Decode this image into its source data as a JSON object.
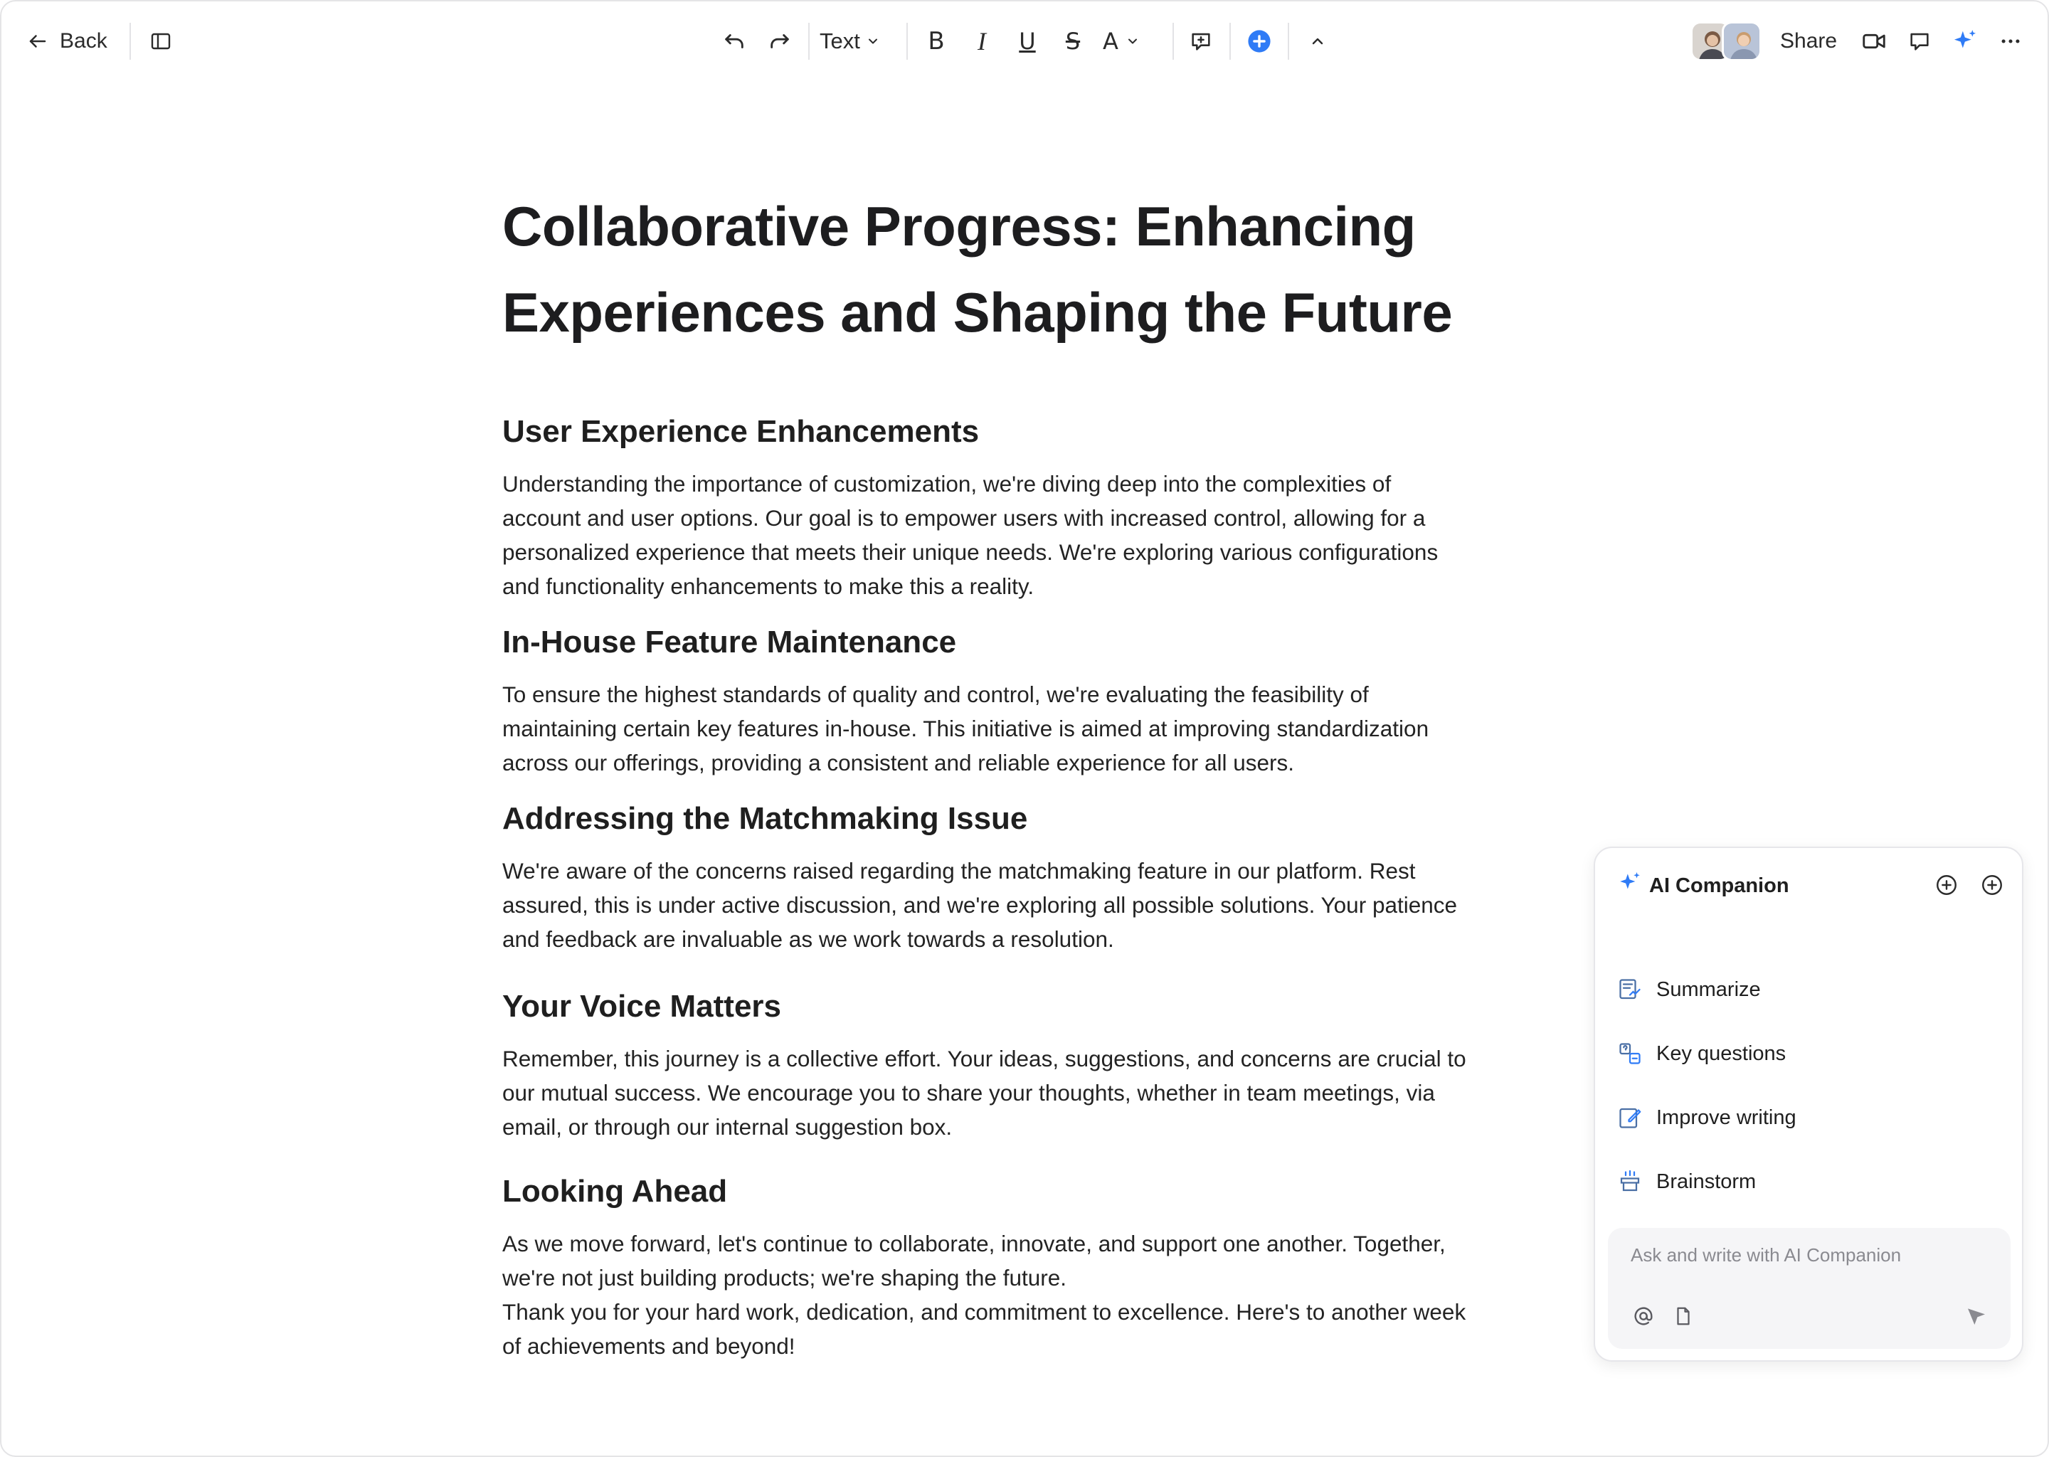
{
  "toolbar": {
    "back_label": "Back",
    "text_style_label": "Text",
    "bold_label": "B",
    "italic_label": "I",
    "underline_label": "U",
    "strike_label": "S",
    "font_color_label": "A",
    "share_label": "Share",
    "icons": [
      "arrow-left-icon",
      "sidebar-toggle-icon",
      "undo-icon",
      "redo-icon",
      "chevron-down-icon",
      "comment-add-icon",
      "plus-circle-icon",
      "chevron-up-icon",
      "video-icon",
      "chat-icon",
      "ai-sparkle-icon",
      "more-icon"
    ],
    "accent_color": "#2f7bf6"
  },
  "document": {
    "title_line1": "Collaborative Progress: Enhancing",
    "title_line2": "Experiences and Shaping the Future",
    "sections": [
      {
        "heading": "User Experience Enhancements",
        "lines": [
          "Understanding the importance of customization, we're diving deep into the complexities of",
          "account and user options. Our goal is to empower users with increased control, allowing for a",
          "personalized experience that meets their unique needs. We're exploring various configurations",
          "and functionality enhancements to make this a reality."
        ]
      },
      {
        "heading": "In-House Feature Maintenance",
        "lines": [
          "To ensure the highest standards of quality and control, we're evaluating the feasibility of",
          "maintaining certain key features in-house. This initiative is aimed at improving standardization",
          "across our offerings, providing a consistent and reliable experience for all users."
        ]
      },
      {
        "heading": "Addressing the Matchmaking Issue",
        "lines": [
          "We're aware of the concerns raised regarding the matchmaking feature in our platform. Rest",
          "assured, this is under active discussion, and we're exploring all possible solutions. Your patience",
          "and feedback are invaluable as we work towards a resolution."
        ]
      },
      {
        "heading": "Your Voice Matters",
        "lines": [
          "Remember, this journey is a collective effort. Your ideas, suggestions, and concerns are crucial to",
          "our mutual success. We encourage you to share your thoughts, whether in team meetings, via",
          "email, or through our internal suggestion box."
        ]
      },
      {
        "heading": "Looking Ahead",
        "lines": [
          "As we move forward, let's continue to collaborate, innovate, and support one another. Together,",
          "we're not just building products; we're shaping the future.",
          "Thank you for your hard work, dedication, and commitment to excellence. Here's to another week",
          "of achievements and beyond!"
        ]
      }
    ]
  },
  "ai_companion": {
    "title": "AI Companion",
    "actions": [
      {
        "label": "Summarize",
        "icon": "summarize-icon"
      },
      {
        "label": "Key questions",
        "icon": "key-questions-icon"
      },
      {
        "label": "Improve writing",
        "icon": "improve-writing-icon"
      },
      {
        "label": "Brainstorm",
        "icon": "brainstorm-icon"
      }
    ],
    "input_placeholder": "Ask and write with AI Companion",
    "input_value": "",
    "input_icons": [
      "at-mention-icon",
      "document-icon",
      "send-icon"
    ]
  }
}
